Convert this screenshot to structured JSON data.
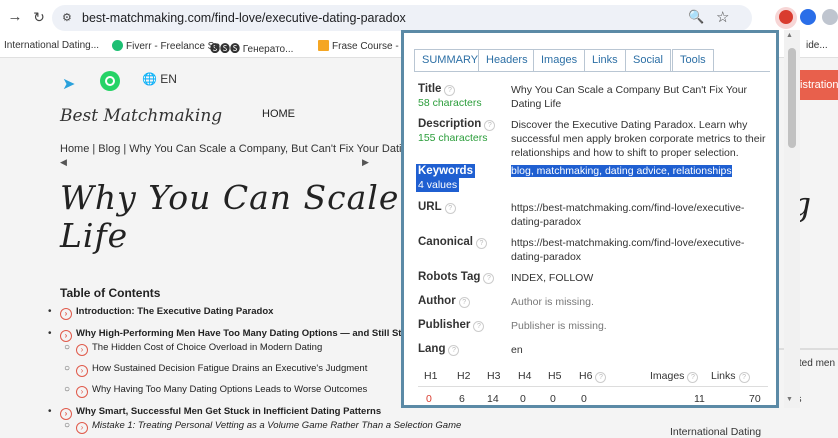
{
  "browser": {
    "url": "best-matchmaking.com/find-love/executive-dating-paradox",
    "site_info_icon": "tune-icon",
    "bookmarks": [
      {
        "label": "International Dating...",
        "color": "#ffffff"
      },
      {
        "label": "Fiverr - Freelance Se...",
        "color": "#1dbf73"
      },
      {
        "label": "🅢🅢🅢 Генерато...",
        "color": "#444444"
      },
      {
        "label": "Frase Course - 🖋...",
        "color": "#f5a623"
      },
      {
        "label": "ide...",
        "color": "#ffffff"
      }
    ]
  },
  "page": {
    "lang_label": "EN",
    "logo_text": "Best Matchmaking",
    "nav_home": "HOME",
    "registration": "istration",
    "breadcrumb": "Home | Blog | Why You Can Scale a Company, But Can't Fix Your Dating Life",
    "headline_line1": "Why You Can Scale a Com",
    "headline_line2": "Life",
    "headline_tail": "g",
    "toc_title": "Table of Contents",
    "toc": [
      "Introduction: The Executive Dating Paradox",
      "Why High-Performing Men Have Too Many Dating Options — and Still Stay Single",
      "The Hidden Cost of Choice Overload in Modern Dating",
      "How Sustained Decision Fatigue Drains an Executive's Judgment",
      "Why Having Too Many Dating Options Leads to Worse Outcomes",
      "Why Smart, Successful Men Get Stuck in Inefficient Dating Patterns",
      "Mistake 1: Treating Personal Vetting as a Volume Game Rather Than a Selection Game"
    ],
    "side_1": "verted men",
    "side_2": "os",
    "side_3": "International Dating"
  },
  "popup": {
    "tabs": [
      "SUMMARY",
      "Headers",
      "Images",
      "Links",
      "Social",
      "Tools"
    ],
    "title_label": "Title",
    "title_count": "58 characters",
    "title_value": "Why You Can Scale a Company But Can't Fix Your Dating Life",
    "desc_label": "Description",
    "desc_count": "155 characters",
    "desc_value": "Discover the Executive Dating Paradox. Learn why successful men apply broken corporate metrics to their relationships and how to shift to proper selection.",
    "keywords_label": "Keywords",
    "keywords_count": "4 values",
    "keywords_value": "blog, matchmaking, dating advice, relationships",
    "url_label": "URL",
    "url_value": "https://best-matchmaking.com/find-love/executive-dating-paradox",
    "canonical_label": "Canonical",
    "canonical_value": "https://best-matchmaking.com/find-love/executive-dating-paradox",
    "robots_label": "Robots Tag",
    "robots_value": "INDEX, FOLLOW",
    "author_label": "Author",
    "author_value": "Author is missing.",
    "publisher_label": "Publisher",
    "publisher_value": "Publisher is missing.",
    "lang_label": "Lang",
    "lang_value": "en",
    "headers": {
      "h1_label": "H1",
      "h2_label": "H2",
      "h3_label": "H3",
      "h4_label": "H4",
      "h5_label": "H5",
      "h6_label": "H6",
      "images_label": "Images",
      "links_label": "Links",
      "h1": "0",
      "h2": "6",
      "h3": "14",
      "h4": "0",
      "h5": "0",
      "h6": "0",
      "images": "11",
      "links": "70"
    },
    "accent_color": "#5b8aa6",
    "highlight_color": "#1f5fd1"
  }
}
